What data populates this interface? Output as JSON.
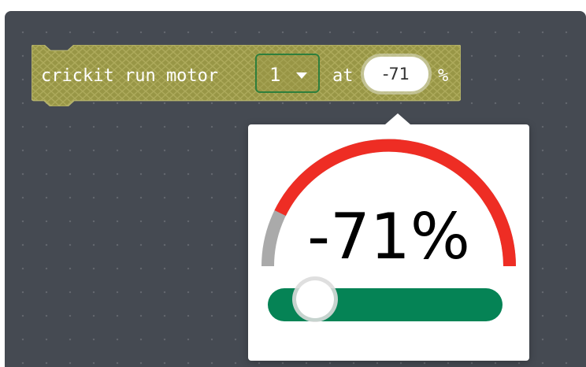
{
  "block": {
    "label_prefix": "crickit run motor",
    "motor_number": "1",
    "label_at": "at",
    "speed_value": "-71",
    "label_percent": "%",
    "color": "#989646"
  },
  "speed_popup": {
    "display": "-71%",
    "speed_fraction": -0.71,
    "gauge_active_color": "#ee2d24",
    "gauge_track_color": "#aaaaaa",
    "slider_color": "#058355"
  },
  "workspace": {
    "background_color": "#454a52"
  }
}
